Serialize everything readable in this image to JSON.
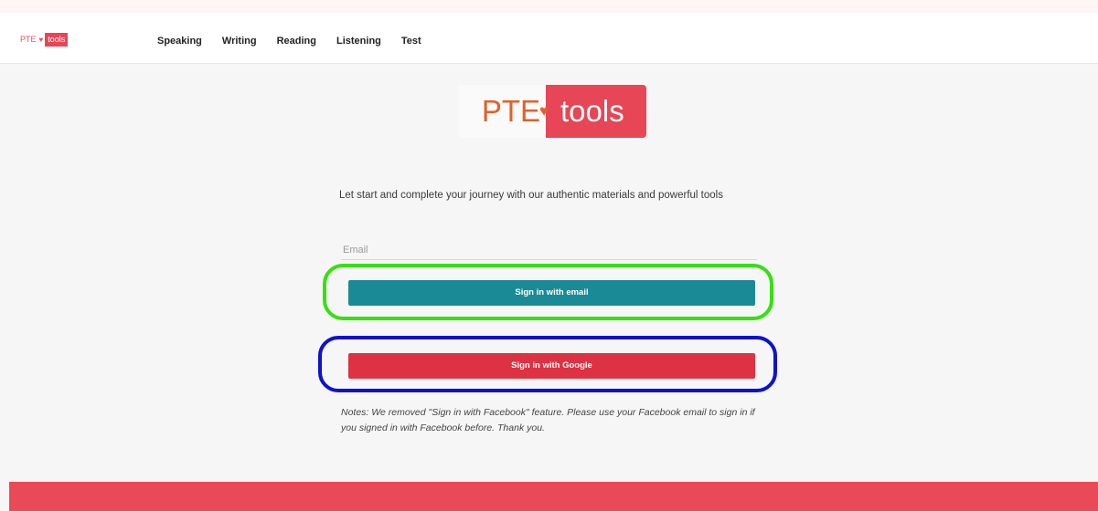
{
  "brand": {
    "left_text": "PTE",
    "right_text": "tools"
  },
  "nav": {
    "items": [
      "Speaking",
      "Writing",
      "Reading",
      "Listening",
      "Test"
    ]
  },
  "logo": {
    "left_text": "PTE",
    "right_text": "tools",
    "icon": "heart-icon"
  },
  "tagline": "Let start and complete your journey with our authentic materials and powerful tools",
  "email": {
    "placeholder": "Email",
    "value": ""
  },
  "buttons": {
    "email_label": "Sign in with email",
    "google_label": "Sign in with Google"
  },
  "notes": "Notes: We removed \"Sign in with Facebook\" feature. Please use your Facebook email to sign in if you signed in with Facebook before. Thank you.",
  "colors": {
    "brand_red": "#e64655",
    "brand_orange": "#e2602a",
    "email_button": "#1a8a97",
    "google_button": "#dc3242",
    "highlight_green": "#35e10f",
    "highlight_blue": "#0f11cf",
    "footer": "#ea4a57"
  }
}
